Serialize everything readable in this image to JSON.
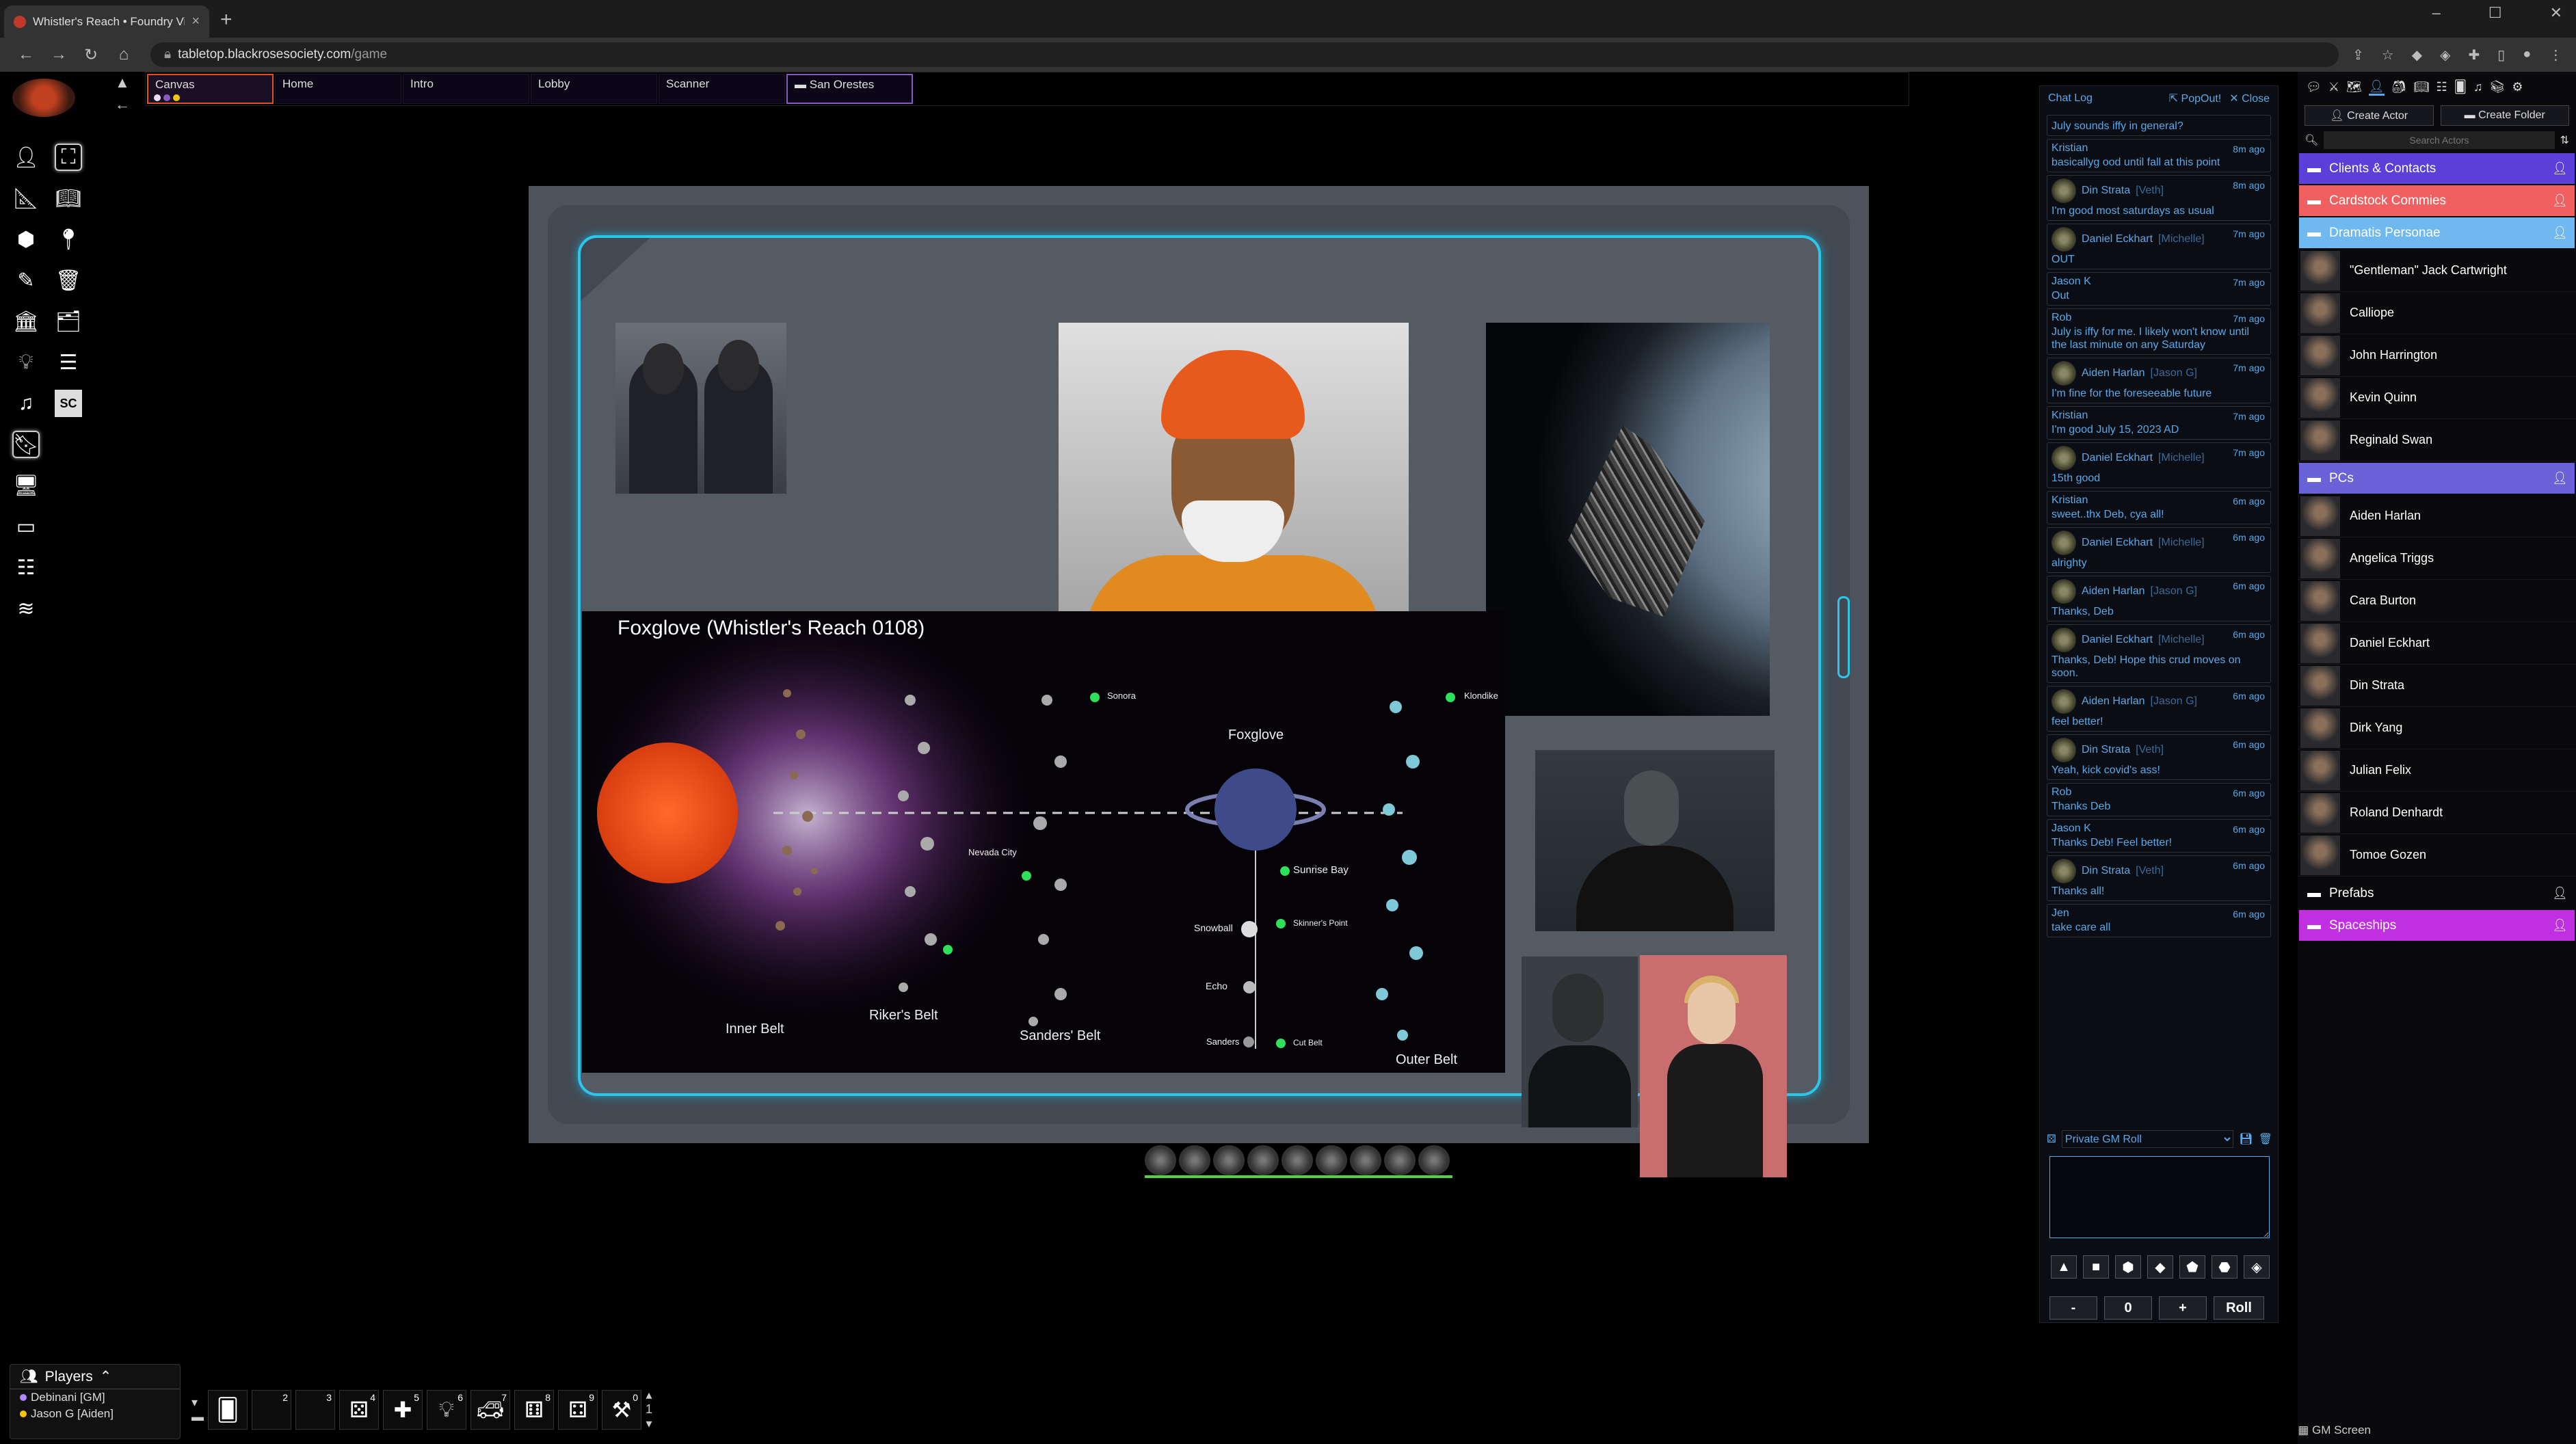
{
  "browser": {
    "tab_title": "Whistler's Reach • Foundry Virtu",
    "url_domain": "tabletop.blackrosesociety.com",
    "url_path": "/game"
  },
  "scenes": [
    {
      "label": "Canvas",
      "active": true
    },
    {
      "label": "Home"
    },
    {
      "label": "Intro"
    },
    {
      "label": "Lobby"
    },
    {
      "label": "Scanner"
    },
    {
      "label": "San Orestes",
      "folder": true
    }
  ],
  "map": {
    "title": "Foxglove (Whistler's Reach 0108)",
    "labels": {
      "inner_belt": "Inner Belt",
      "rikers_belt": "Riker's Belt",
      "sanders_belt": "Sanders' Belt",
      "outer_belt": "Outer Belt",
      "foxglove": "Foxglove",
      "sonora": "Sonora",
      "klondike": "Klondike",
      "nevada_city": "Nevada City",
      "sunrise_bay": "Sunrise Bay",
      "snowball": "Snowball",
      "skinners_point": "Skinner's Point",
      "echo": "Echo",
      "sanders": "Sanders",
      "cut_belt": "Cut Belt"
    }
  },
  "chat": {
    "title": "Chat Log",
    "popout": "PopOut!",
    "close": "Close",
    "messages": [
      {
        "author": "",
        "alias": "",
        "time": "",
        "text": "July sounds iffy in general?",
        "avatar": false
      },
      {
        "author": "Kristian",
        "alias": "",
        "time": "8m ago",
        "text": "basicallyg ood until fall at this point",
        "avatar": false
      },
      {
        "author": "Din Strata",
        "alias": "[Veth]",
        "time": "8m ago",
        "text": "I'm good most saturdays as usual",
        "avatar": true
      },
      {
        "author": "Daniel Eckhart",
        "alias": "[Michelle]",
        "time": "7m ago",
        "text": "OUT",
        "avatar": true
      },
      {
        "author": "Jason K",
        "alias": "",
        "time": "7m ago",
        "text": "Out",
        "avatar": false
      },
      {
        "author": "Rob",
        "alias": "",
        "time": "7m ago",
        "text": "July is iffy for me. I likely won't know until the last minute on any Saturday",
        "avatar": false
      },
      {
        "author": "Aiden Harlan",
        "alias": "[Jason G]",
        "time": "7m ago",
        "text": "I'm fine for the foreseeable future",
        "avatar": true
      },
      {
        "author": "Kristian",
        "alias": "",
        "time": "7m ago",
        "text": "I'm good July 15, 2023 AD",
        "avatar": false
      },
      {
        "author": "Daniel Eckhart",
        "alias": "[Michelle]",
        "time": "7m ago",
        "text": "15th good",
        "avatar": true
      },
      {
        "author": "Kristian",
        "alias": "",
        "time": "6m ago",
        "text": "sweet..thx Deb, cya all!",
        "avatar": false
      },
      {
        "author": "Daniel Eckhart",
        "alias": "[Michelle]",
        "time": "6m ago",
        "text": "alrighty",
        "avatar": true
      },
      {
        "author": "Aiden Harlan",
        "alias": "[Jason G]",
        "time": "6m ago",
        "text": "Thanks, Deb",
        "avatar": true
      },
      {
        "author": "Daniel Eckhart",
        "alias": "[Michelle]",
        "time": "6m ago",
        "text": "Thanks, Deb! Hope this crud moves on soon.",
        "avatar": true
      },
      {
        "author": "Aiden Harlan",
        "alias": "[Jason G]",
        "time": "6m ago",
        "text": "feel better!",
        "avatar": true
      },
      {
        "author": "Din Strata",
        "alias": "[Veth]",
        "time": "6m ago",
        "text": "Yeah, kick covid's ass!",
        "avatar": true
      },
      {
        "author": "Rob",
        "alias": "",
        "time": "6m ago",
        "text": "Thanks Deb",
        "avatar": false
      },
      {
        "author": "Jason K",
        "alias": "",
        "time": "6m ago",
        "text": "Thanks Deb! Feel better!",
        "avatar": false
      },
      {
        "author": "Din Strata",
        "alias": "[Veth]",
        "time": "6m ago",
        "text": "Thanks all!",
        "avatar": true
      },
      {
        "author": "Jen",
        "alias": "",
        "time": "6m ago",
        "text": "take care all",
        "avatar": false
      }
    ],
    "roll_mode": "Private GM Roll",
    "modifier": "0",
    "minus": "-",
    "plus": "+",
    "roll": "Roll"
  },
  "sidebar": {
    "create_actor": "Create Actor",
    "create_folder": "Create Folder",
    "search_placeholder": "Search Actors",
    "folders": [
      {
        "name": "Clients & Contacts",
        "color": "#5b3fd9",
        "actors": []
      },
      {
        "name": "Cardstock Commies",
        "color": "#f06060",
        "actors": []
      },
      {
        "name": "Dramatis Personae",
        "color": "#6fb8f0",
        "actors": [
          "\"Gentleman\" Jack Cartwright",
          "Calliope",
          "John Harrington",
          "Kevin Quinn",
          "Reginald Swan"
        ]
      },
      {
        "name": "PCs",
        "color": "#6a63d8",
        "actors": [
          "Aiden Harlan",
          "Angelica Triggs",
          "Cara Burton",
          "Daniel Eckhart",
          "Din Strata",
          "Dirk Yang",
          "Julian Felix",
          "Roland Denhardt",
          "Tomoe Gozen"
        ]
      },
      {
        "name": "Prefabs",
        "color": "#0a0a0c",
        "actors": []
      },
      {
        "name": "Spaceships",
        "color": "#c030e0",
        "actors": []
      }
    ]
  },
  "players": {
    "title": "Players",
    "list": [
      {
        "name": "Debinani [GM]",
        "color": "#b388ff"
      },
      {
        "name": "Jason G [Aiden]",
        "color": "#f1c40f"
      }
    ]
  },
  "hotbar": {
    "slots": [
      "",
      "2",
      "3",
      "4",
      "5",
      "6",
      "7",
      "8",
      "9",
      "0"
    ],
    "page": "1"
  },
  "gm_screen": "GM Screen"
}
